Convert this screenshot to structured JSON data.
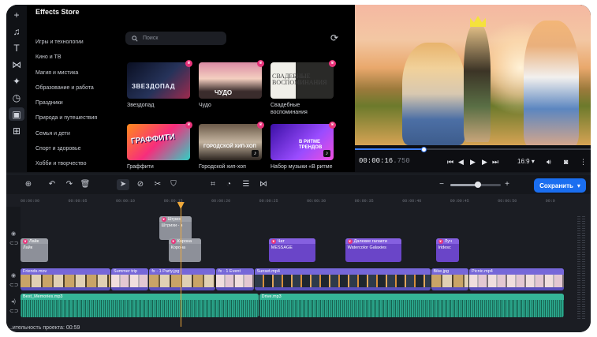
{
  "sidebar_tools": [
    {
      "name": "add",
      "glyph": "+"
    },
    {
      "name": "music",
      "glyph": "♫"
    },
    {
      "name": "text",
      "glyph": "T"
    },
    {
      "name": "transitions",
      "glyph": "⋈"
    },
    {
      "name": "filters",
      "glyph": "✦"
    },
    {
      "name": "stickers",
      "glyph": "◷"
    },
    {
      "name": "store",
      "glyph": "▣"
    },
    {
      "name": "more",
      "glyph": "⊞"
    }
  ],
  "store": {
    "title": "Effects Store",
    "search_placeholder": "Поиск",
    "categories": [
      "Игры и технологии",
      "Кино и ТВ",
      "Магия и мистика",
      "Образование и работа",
      "Праздники",
      "Природа и путешествия",
      "Семья и дети",
      "Спорт и здоровье",
      "Хобби и творчество"
    ],
    "packs": [
      {
        "label": "Звездопад",
        "thumb_text": "ЗВЕЗДОПАД",
        "style": "t-zvezd",
        "music": false
      },
      {
        "label": "Чудо",
        "thumb_text": "ЧУДО",
        "style": "t-chudo",
        "music": false
      },
      {
        "label": "Свадебные воспоминания",
        "thumb_text": "СВАДЕБНЫЕ ВОСПОМИНАНИЯ",
        "style": "t-svad",
        "music": false
      },
      {
        "label": "Граффити",
        "thumb_text": "ГРАФФИТИ",
        "style": "t-graf",
        "music": false
      },
      {
        "label": "Городской хип-хоп",
        "thumb_text": "ГОРОДСКОЙ ХИП-ХОП",
        "style": "t-hip",
        "music": true
      },
      {
        "label": "Набор музыки «В ритме",
        "thumb_text": "В РИТМЕ ТРЕНДОВ",
        "style": "t-ritm",
        "music": true
      }
    ]
  },
  "player": {
    "time_main": "00:00:16",
    "time_ms": ".750",
    "progress": 0.29,
    "aspect": "16:9",
    "aspect_caret": "▾"
  },
  "toolbar": {
    "save_label": "Сохранить",
    "save_caret": "▾",
    "zoom_level": 0.55
  },
  "timeline": {
    "ruler": [
      "00:00:00",
      "00:00:05",
      "00:00:10",
      "00:00:15",
      "00:00:20",
      "00:00:25",
      "00:00:30",
      "00:00:35",
      "00:00:40",
      "00:00:45",
      "00:00:50",
      "00:0"
    ],
    "playhead_seconds": 16.75,
    "seconds_visible": 57,
    "duration_label": "...ительность проекта: 00:59",
    "titles": [
      {
        "head": "Штрих",
        "sub": "Штрихи - з",
        "start": 14.5,
        "end": 18.0,
        "row": 0,
        "kind": "c-gray"
      },
      {
        "head": "Лайк",
        "sub": "Лайк",
        "start": 0.0,
        "end": 3.0,
        "row": 1,
        "kind": "c-gray"
      },
      {
        "head": "Корона",
        "sub": "Корона",
        "start": 15.5,
        "end": 19.0,
        "row": 1,
        "kind": "c-gray"
      },
      {
        "head": "Чат",
        "sub": "MESSAGE",
        "start": 26.0,
        "end": 31.0,
        "row": 1,
        "kind": "c-purple"
      },
      {
        "head": "Далекие галакти",
        "sub": "Watercolor Galaxies",
        "start": 34.0,
        "end": 40.0,
        "row": 1,
        "kind": "c-purple"
      },
      {
        "head": "Луч",
        "sub": "Iridesc",
        "start": 43.5,
        "end": 46.0,
        "row": 1,
        "kind": "c-purple"
      }
    ],
    "video": [
      {
        "head": "Friends.mov",
        "start": 0.0,
        "end": 9.5,
        "strip": ""
      },
      {
        "head": "Summer trip",
        "start": 9.5,
        "end": 13.5,
        "strip": "b"
      },
      {
        "head": "fx · 1  Party.jpg",
        "start": 13.5,
        "end": 20.5,
        "strip": ""
      },
      {
        "head": "fx · 1  Event",
        "start": 20.5,
        "end": 24.5,
        "strip": "b"
      },
      {
        "head": "Sunset.mp4",
        "start": 24.5,
        "end": 43.0,
        "strip": "c"
      },
      {
        "head": "Bike.jpg",
        "start": 43.0,
        "end": 47.0,
        "strip": ""
      },
      {
        "head": "Picnic.mp4",
        "start": 47.0,
        "end": 57.0,
        "strip": "b"
      }
    ],
    "audio": [
      {
        "head": "Best_Memories.mp3",
        "start": 0.0,
        "end": 25.0
      },
      {
        "head": "Drive.mp3",
        "start": 25.0,
        "end": 57.0
      }
    ]
  }
}
